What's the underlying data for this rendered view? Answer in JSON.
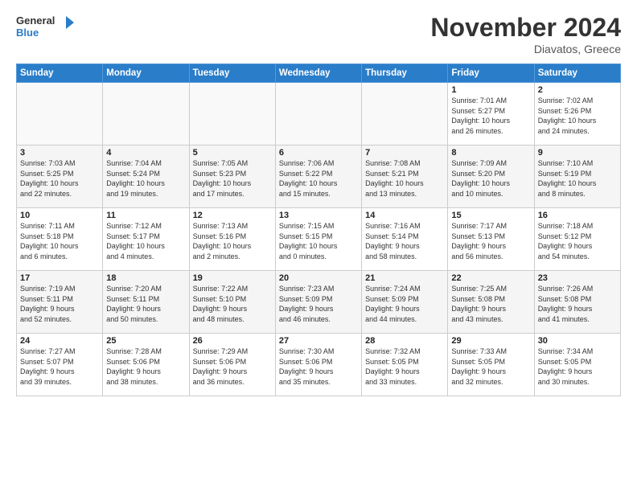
{
  "logo": {
    "line1": "General",
    "line2": "Blue"
  },
  "title": "November 2024",
  "location": "Diavatos, Greece",
  "weekdays": [
    "Sunday",
    "Monday",
    "Tuesday",
    "Wednesday",
    "Thursday",
    "Friday",
    "Saturday"
  ],
  "weeks": [
    [
      {
        "day": "",
        "info": ""
      },
      {
        "day": "",
        "info": ""
      },
      {
        "day": "",
        "info": ""
      },
      {
        "day": "",
        "info": ""
      },
      {
        "day": "",
        "info": ""
      },
      {
        "day": "1",
        "info": "Sunrise: 7:01 AM\nSunset: 5:27 PM\nDaylight: 10 hours\nand 26 minutes."
      },
      {
        "day": "2",
        "info": "Sunrise: 7:02 AM\nSunset: 5:26 PM\nDaylight: 10 hours\nand 24 minutes."
      }
    ],
    [
      {
        "day": "3",
        "info": "Sunrise: 7:03 AM\nSunset: 5:25 PM\nDaylight: 10 hours\nand 22 minutes."
      },
      {
        "day": "4",
        "info": "Sunrise: 7:04 AM\nSunset: 5:24 PM\nDaylight: 10 hours\nand 19 minutes."
      },
      {
        "day": "5",
        "info": "Sunrise: 7:05 AM\nSunset: 5:23 PM\nDaylight: 10 hours\nand 17 minutes."
      },
      {
        "day": "6",
        "info": "Sunrise: 7:06 AM\nSunset: 5:22 PM\nDaylight: 10 hours\nand 15 minutes."
      },
      {
        "day": "7",
        "info": "Sunrise: 7:08 AM\nSunset: 5:21 PM\nDaylight: 10 hours\nand 13 minutes."
      },
      {
        "day": "8",
        "info": "Sunrise: 7:09 AM\nSunset: 5:20 PM\nDaylight: 10 hours\nand 10 minutes."
      },
      {
        "day": "9",
        "info": "Sunrise: 7:10 AM\nSunset: 5:19 PM\nDaylight: 10 hours\nand 8 minutes."
      }
    ],
    [
      {
        "day": "10",
        "info": "Sunrise: 7:11 AM\nSunset: 5:18 PM\nDaylight: 10 hours\nand 6 minutes."
      },
      {
        "day": "11",
        "info": "Sunrise: 7:12 AM\nSunset: 5:17 PM\nDaylight: 10 hours\nand 4 minutes."
      },
      {
        "day": "12",
        "info": "Sunrise: 7:13 AM\nSunset: 5:16 PM\nDaylight: 10 hours\nand 2 minutes."
      },
      {
        "day": "13",
        "info": "Sunrise: 7:15 AM\nSunset: 5:15 PM\nDaylight: 10 hours\nand 0 minutes."
      },
      {
        "day": "14",
        "info": "Sunrise: 7:16 AM\nSunset: 5:14 PM\nDaylight: 9 hours\nand 58 minutes."
      },
      {
        "day": "15",
        "info": "Sunrise: 7:17 AM\nSunset: 5:13 PM\nDaylight: 9 hours\nand 56 minutes."
      },
      {
        "day": "16",
        "info": "Sunrise: 7:18 AM\nSunset: 5:12 PM\nDaylight: 9 hours\nand 54 minutes."
      }
    ],
    [
      {
        "day": "17",
        "info": "Sunrise: 7:19 AM\nSunset: 5:11 PM\nDaylight: 9 hours\nand 52 minutes."
      },
      {
        "day": "18",
        "info": "Sunrise: 7:20 AM\nSunset: 5:11 PM\nDaylight: 9 hours\nand 50 minutes."
      },
      {
        "day": "19",
        "info": "Sunrise: 7:22 AM\nSunset: 5:10 PM\nDaylight: 9 hours\nand 48 minutes."
      },
      {
        "day": "20",
        "info": "Sunrise: 7:23 AM\nSunset: 5:09 PM\nDaylight: 9 hours\nand 46 minutes."
      },
      {
        "day": "21",
        "info": "Sunrise: 7:24 AM\nSunset: 5:09 PM\nDaylight: 9 hours\nand 44 minutes."
      },
      {
        "day": "22",
        "info": "Sunrise: 7:25 AM\nSunset: 5:08 PM\nDaylight: 9 hours\nand 43 minutes."
      },
      {
        "day": "23",
        "info": "Sunrise: 7:26 AM\nSunset: 5:08 PM\nDaylight: 9 hours\nand 41 minutes."
      }
    ],
    [
      {
        "day": "24",
        "info": "Sunrise: 7:27 AM\nSunset: 5:07 PM\nDaylight: 9 hours\nand 39 minutes."
      },
      {
        "day": "25",
        "info": "Sunrise: 7:28 AM\nSunset: 5:06 PM\nDaylight: 9 hours\nand 38 minutes."
      },
      {
        "day": "26",
        "info": "Sunrise: 7:29 AM\nSunset: 5:06 PM\nDaylight: 9 hours\nand 36 minutes."
      },
      {
        "day": "27",
        "info": "Sunrise: 7:30 AM\nSunset: 5:06 PM\nDaylight: 9 hours\nand 35 minutes."
      },
      {
        "day": "28",
        "info": "Sunrise: 7:32 AM\nSunset: 5:05 PM\nDaylight: 9 hours\nand 33 minutes."
      },
      {
        "day": "29",
        "info": "Sunrise: 7:33 AM\nSunset: 5:05 PM\nDaylight: 9 hours\nand 32 minutes."
      },
      {
        "day": "30",
        "info": "Sunrise: 7:34 AM\nSunset: 5:05 PM\nDaylight: 9 hours\nand 30 minutes."
      }
    ]
  ]
}
